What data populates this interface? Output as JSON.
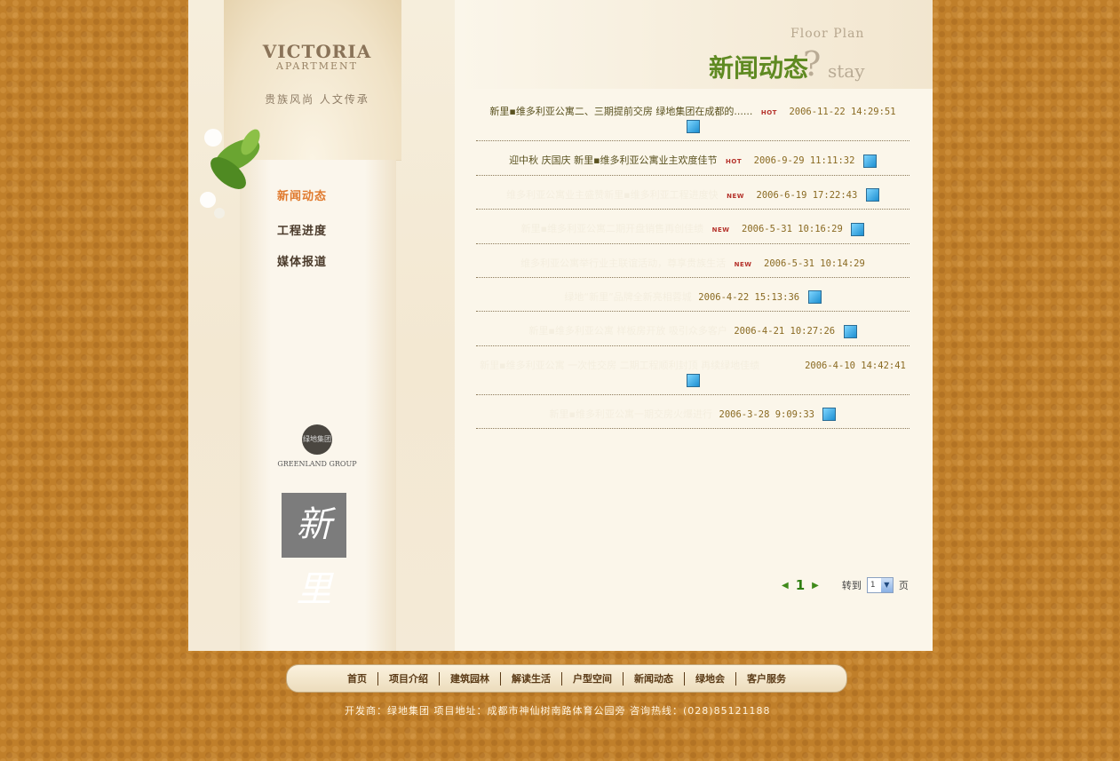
{
  "brand": {
    "title": "VICTORIA",
    "subtitle": "APARTMENT",
    "slogan": "贵族风尚 人文传承"
  },
  "side_nav": {
    "news": "新闻动态",
    "progress": "工程进度",
    "media": "媒体报道"
  },
  "logos": {
    "greenland_text": "GREENLAND GROUP",
    "greenland_mark": "绿地集团",
    "xinli_mark": "新里"
  },
  "header": {
    "floor_plan": "Floor Plan",
    "title": "新闻动态",
    "stay": "stay"
  },
  "news": [
    {
      "text": "新里▪维多利亚公寓二、三期提前交房 绿地集团在成都的......",
      "badge": "HOT",
      "date": "2006-11-22 14:29:51"
    },
    {
      "text": "迎中秋 庆国庆 新里▪维多利亚公寓业主欢度佳节",
      "badge": "HOT",
      "date": "2006-9-29 11:11:32"
    },
    {
      "text": "维多利亚公寓业主盛赞新里▪维多利亚工程进度快",
      "badge": "NEW",
      "date": "2006-6-19 17:22:43"
    },
    {
      "text": "新里▪维多利亚公寓二期开盘销售再创佳绩",
      "badge": "NEW",
      "date": "2006-5-31 10:16:29"
    },
    {
      "text": "维多利亚公寓举行业主联谊活动，尊享贵族生活",
      "badge": "NEW",
      "date": "2006-5-31 10:14:29"
    },
    {
      "text": "绿地“新里”品牌全新亮相蓉城",
      "badge": "",
      "date": "2006-4-22 15:13:36"
    },
    {
      "text": "新里▪维多利亚公寓 样板房开放 吸引众多客户",
      "badge": "",
      "date": "2006-4-21 10:27:26"
    },
    {
      "text": "新里▪维多利亚公寓 一次性交房 二期工程顺利封顶 再续绿地佳绩",
      "badge": "",
      "date": "2006-4-10 14:42:41"
    },
    {
      "text": "新里▪维多利亚公寓一期交房火爆进行",
      "badge": "",
      "date": "2006-3-28 9:09:33"
    }
  ],
  "pager": {
    "current": "1",
    "goto_label": "转到",
    "select_value": "1",
    "page_label": "页",
    "prev": "◀",
    "next": "▶"
  },
  "bottom_nav": [
    "首页",
    "项目介绍",
    "建筑园林",
    "解读生活",
    "户型空间",
    "新闻动态",
    "绿地会",
    "客户服务"
  ],
  "footer": "开发商：绿地集团   项目地址：成都市神仙树南路体育公园旁   咨询热线：(028)85121188"
}
